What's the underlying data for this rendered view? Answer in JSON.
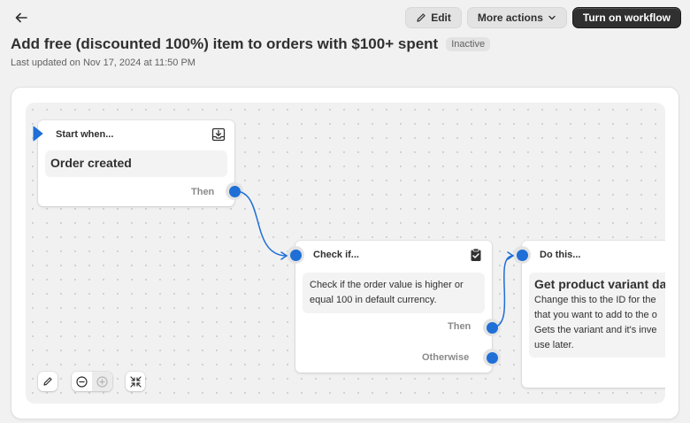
{
  "header": {
    "edit_label": "Edit",
    "more_actions_label": "More actions",
    "turn_on_label": "Turn on workflow",
    "title": "Add free (discounted 100%) item to orders with $100+ spent",
    "status": "Inactive",
    "last_updated": "Last updated on Nov 17, 2024 at 11:50 PM"
  },
  "workflow": {
    "start": {
      "heading": "Start when...",
      "trigger": "Order created",
      "port_then": "Then"
    },
    "condition": {
      "heading": "Check if...",
      "description": "Check if the order value is higher or equal 100 in default currency.",
      "port_then": "Then",
      "port_otherwise": "Otherwise"
    },
    "action": {
      "heading": "Do this...",
      "title": "Get product variant da",
      "description_lines": [
        "Change this to the ID for the",
        "that you want to add to the o",
        "Gets the variant and it's inve",
        "use later."
      ]
    }
  },
  "colors": {
    "accent": "#1f6fd6",
    "primary_button": "#303030"
  },
  "icons": {
    "back": "arrow-left-icon",
    "edit": "pencil-icon",
    "more": "chevron-down-icon",
    "trigger": "download-tray-icon",
    "condition": "clipboard-check-icon",
    "tool_edit": "pencil-icon",
    "zoom_out": "zoom-out-icon",
    "zoom_in": "zoom-in-icon",
    "fit": "collapse-arrows-icon"
  }
}
